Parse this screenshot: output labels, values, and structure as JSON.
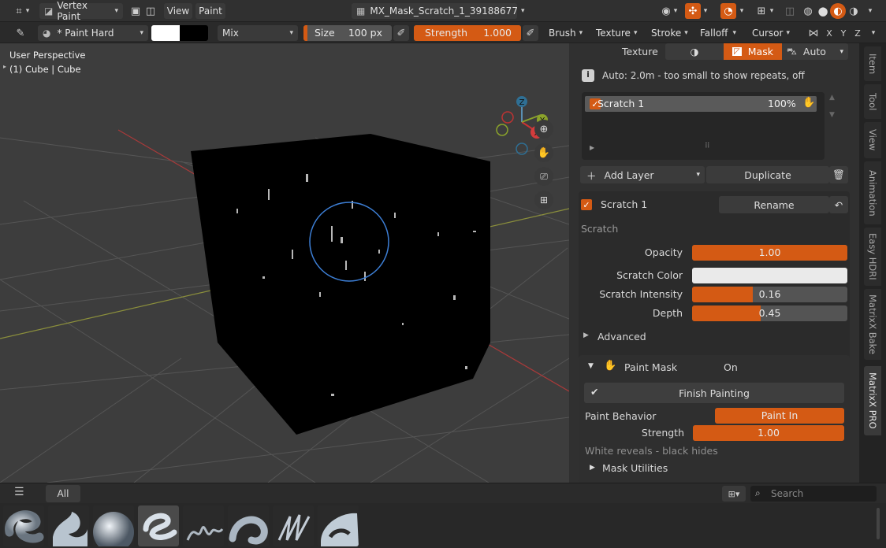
{
  "header": {
    "mode": "Vertex Paint",
    "menus": [
      "View",
      "Paint"
    ],
    "file_name": "MX_Mask_Scratch_1_39188677"
  },
  "toolbar": {
    "brush_name": "* Paint Hard",
    "blend_mode": "Mix",
    "size_label": "Size",
    "size_value": "100 px",
    "strength_label": "Strength",
    "strength_value": "1.000",
    "menus": [
      "Brush",
      "Texture",
      "Stroke",
      "Falloff",
      "Cursor"
    ],
    "axes": [
      "X",
      "Y",
      "Z"
    ]
  },
  "viewport": {
    "view_name": "User Perspective",
    "object_info": "(1) Cube | Cube",
    "gizmo": {
      "x": "X",
      "y": "Y",
      "z": "Z"
    }
  },
  "panel": {
    "texture_label": "Texture",
    "mask_label": "Mask",
    "auto_label": "Auto",
    "info_text": "Auto: 2.0m - too small to show repeats, off",
    "layer": {
      "name": "Scratch 1",
      "percent": "100%"
    },
    "add_layer": "Add Layer",
    "duplicate": "Duplicate",
    "active_name": "Scratch 1",
    "rename": "Rename",
    "section": "Scratch",
    "opacity": {
      "label": "Opacity",
      "value": "1.00",
      "fraction": 1.0
    },
    "scratch_color": {
      "label": "Scratch Color",
      "color": "#eaeaea"
    },
    "scratch_intensity": {
      "label": "Scratch Intensity",
      "value": "0.16",
      "fraction": 0.39
    },
    "depth": {
      "label": "Depth",
      "value": "0.45",
      "fraction": 0.44
    },
    "advanced": "Advanced",
    "paint_mask": {
      "label": "Paint Mask",
      "state": "On"
    },
    "finish_painting": "Finish Painting",
    "paint_behavior": {
      "label": "Paint Behavior",
      "value": "Paint In"
    },
    "strength": {
      "label": "Strength",
      "value": "1.00",
      "fraction": 1.0
    },
    "hint": "White reveals - black hides",
    "mask_utilities": "Mask Utilities"
  },
  "side_tabs": [
    "Item",
    "Tool",
    "View",
    "Animation",
    "Easy HDRI",
    "MatrixX Bake",
    "MatrixX PRO"
  ],
  "bottom": {
    "filter_all": "All",
    "search_placeholder": "Search"
  },
  "colors": {
    "accent": "#d45a14",
    "selection_blue": "#3d7fd6"
  }
}
